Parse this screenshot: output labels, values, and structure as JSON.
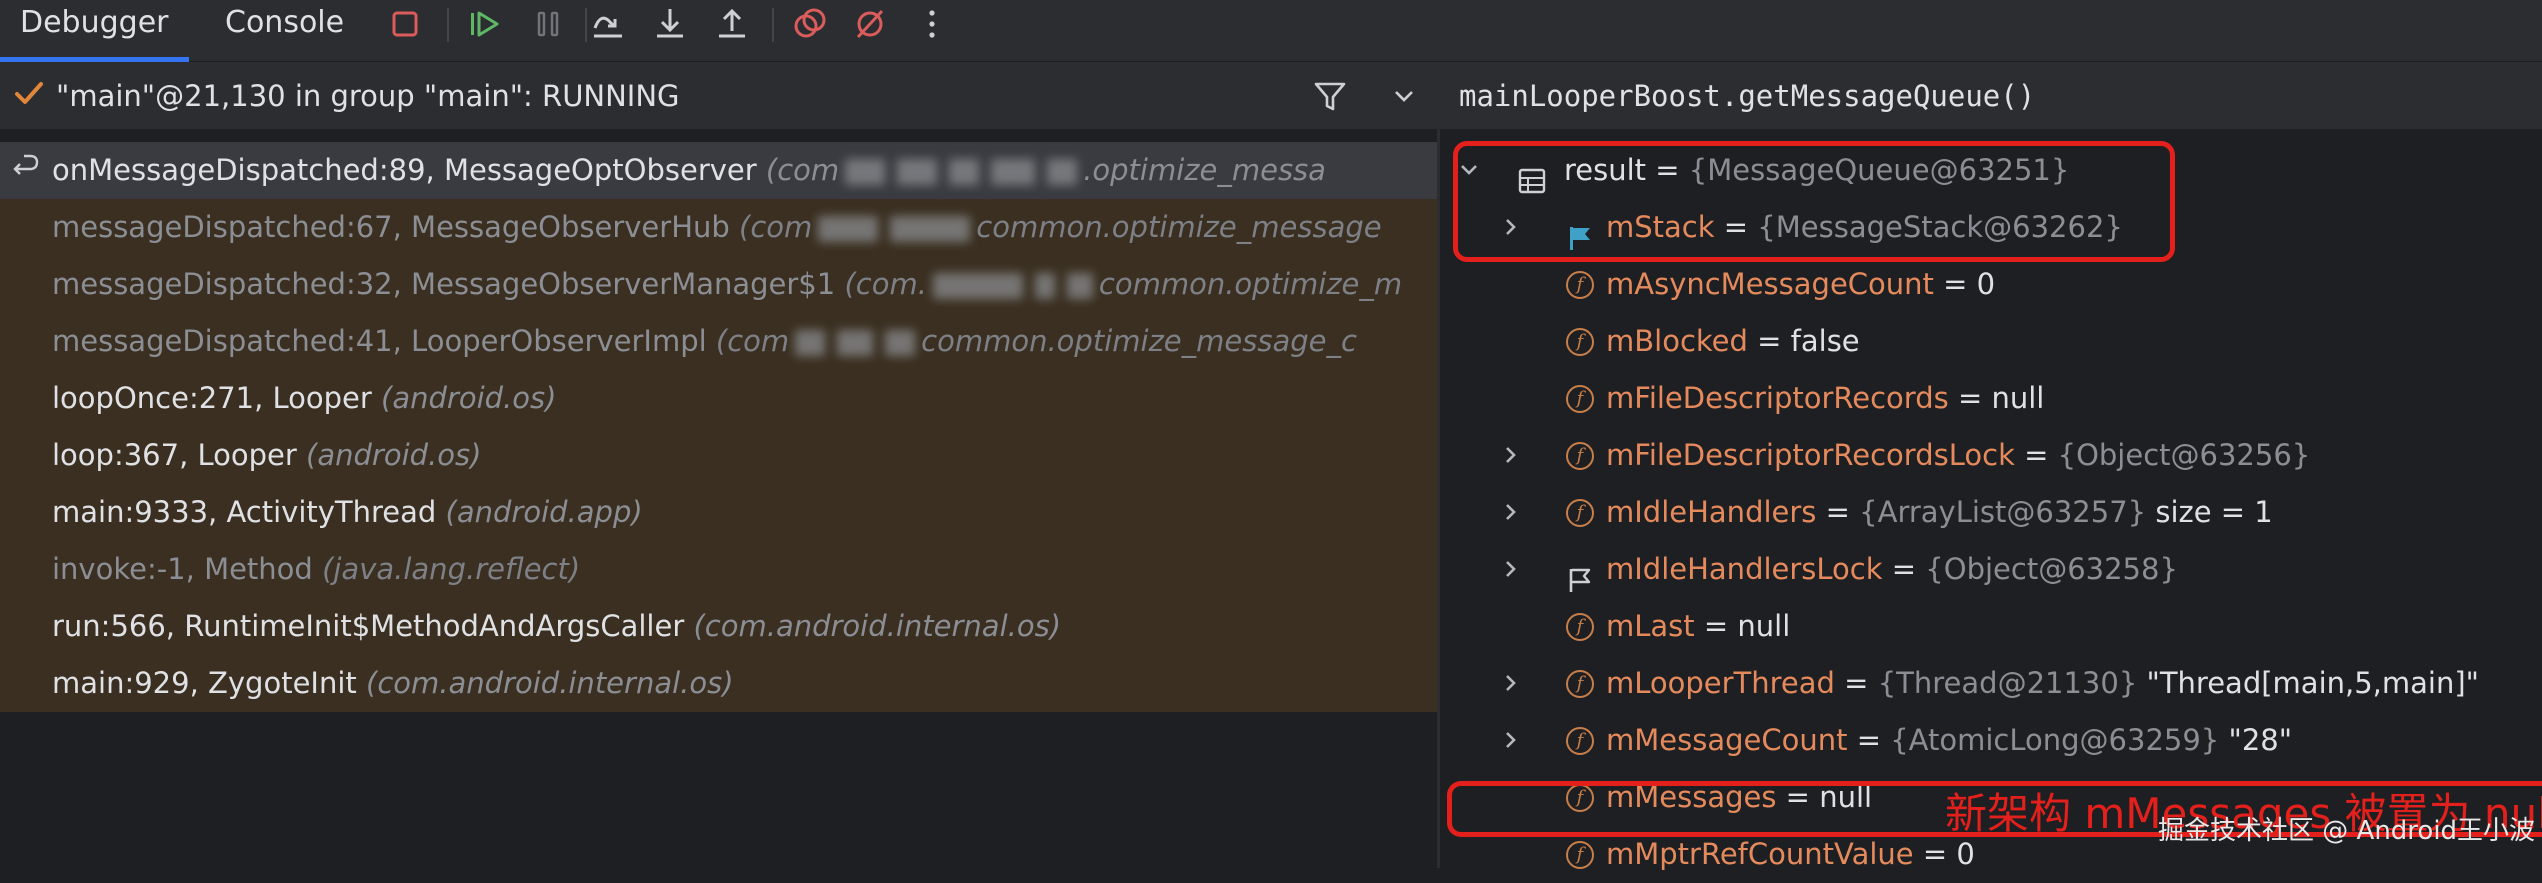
{
  "toolbar": {
    "tabs": [
      {
        "label": "Debugger",
        "active": true
      },
      {
        "label": "Console",
        "active": false
      }
    ],
    "icons": [
      "stop-icon",
      "resume-icon",
      "pause-icon",
      "step-over-icon",
      "step-into-icon",
      "step-out-icon",
      "view-breakpoints-icon",
      "mute-breakpoints-icon",
      "more-options-icon"
    ],
    "accent_color": "#3574f0"
  },
  "thread": {
    "label": "\"main\"@21,130 in group \"main\": RUNNING",
    "status_icon": "checkmark-icon"
  },
  "frames": [
    {
      "method": "onMessageDispatched:89, MessageOptObserver",
      "pkg_start": "(com",
      "pkg_end": ".optimize_messa",
      "selected": true,
      "dim": false
    },
    {
      "method": "messageDispatched:67, MessageObserverHub",
      "pkg_start": "(com",
      "pkg_end": "common.optimize_message",
      "selected": false,
      "dim": true
    },
    {
      "method": "messageDispatched:32, MessageObserverManager$1",
      "pkg_start": "(com.",
      "pkg_end": "common.optimize_m",
      "selected": false,
      "dim": true
    },
    {
      "method": "messageDispatched:41, LooperObserverImpl",
      "pkg_start": "(com",
      "pkg_end": "common.optimize_message_c",
      "selected": false,
      "dim": true
    },
    {
      "method": "loopOnce:271, Looper",
      "pkg": "(android.os)",
      "selected": false,
      "dim": false
    },
    {
      "method": "loop:367, Looper",
      "pkg": "(android.os)",
      "selected": false,
      "dim": false
    },
    {
      "method": "main:9333, ActivityThread",
      "pkg": "(android.app)",
      "selected": false,
      "dim": false
    },
    {
      "method": "invoke:-1, Method",
      "pkg": "(java.lang.reflect)",
      "selected": false,
      "dim": true
    },
    {
      "method": "run:566, RuntimeInit$MethodAndArgsCaller",
      "pkg": "(com.android.internal.os)",
      "selected": false,
      "dim": false
    },
    {
      "method": "main:929, ZygoteInit",
      "pkg": "(com.android.internal.os)",
      "selected": false,
      "dim": false
    }
  ],
  "expression": "mainLooperBoost.getMessageQueue()",
  "variables": [
    {
      "name": "result",
      "eq": " = ",
      "ref": "{MessageQueue@63251}",
      "value": "",
      "icon": "table-icon",
      "expandable": "expanded",
      "level": 0,
      "name_color": "#dfe1e5"
    },
    {
      "name": "mStack",
      "eq": " = ",
      "ref": "{MessageStack@63262}",
      "value": "",
      "icon": "flag-icon",
      "expandable": "collapsed",
      "level": 1
    },
    {
      "name": "mAsyncMessageCount",
      "eq": " = ",
      "ref": "",
      "value": "0",
      "icon": "field-icon",
      "expandable": "none",
      "level": 1
    },
    {
      "name": "mBlocked",
      "eq": " = ",
      "ref": "",
      "value": "false",
      "icon": "field-icon",
      "expandable": "none",
      "level": 1
    },
    {
      "name": "mFileDescriptorRecords",
      "eq": " = ",
      "ref": "",
      "value": "null",
      "icon": "field-icon",
      "expandable": "none",
      "level": 1
    },
    {
      "name": "mFileDescriptorRecordsLock",
      "eq": " = ",
      "ref": "{Object@63256}",
      "value": "",
      "icon": "field-icon",
      "expandable": "collapsed",
      "level": 1
    },
    {
      "name": "mIdleHandlers",
      "eq": " = ",
      "ref": "{ArrayList@63257}",
      "value": " size = 1",
      "icon": "field-icon",
      "expandable": "collapsed",
      "level": 1
    },
    {
      "name": "mIdleHandlersLock",
      "eq": " = ",
      "ref": "{Object@63258}",
      "value": "",
      "icon": "flag-outline-icon",
      "expandable": "collapsed",
      "level": 1
    },
    {
      "name": "mLast",
      "eq": " = ",
      "ref": "",
      "value": "null",
      "icon": "field-icon",
      "expandable": "none",
      "level": 1
    },
    {
      "name": "mLooperThread",
      "eq": " = ",
      "ref": "{Thread@21130}",
      "value": " \"Thread[main,5,main]\"",
      "icon": "field-icon",
      "expandable": "collapsed",
      "level": 1
    },
    {
      "name": "mMessageCount",
      "eq": " = ",
      "ref": "{AtomicLong@63259}",
      "value": " \"28\"",
      "icon": "field-icon",
      "expandable": "collapsed",
      "level": 1
    },
    {
      "name": "mMessages",
      "eq": " = ",
      "ref": "",
      "value": "null",
      "icon": "field-icon",
      "expandable": "none",
      "level": 1
    },
    {
      "name": "mMptrRefCountValue",
      "eq": " = ",
      "ref": "",
      "value": "0",
      "icon": "field-icon",
      "expandable": "none",
      "level": 1
    }
  ],
  "annotation": "新架构 mMessages 被置为 null",
  "watermark": "掘金技术社区 @ Android王小波",
  "highlight_color": "#e3201b"
}
